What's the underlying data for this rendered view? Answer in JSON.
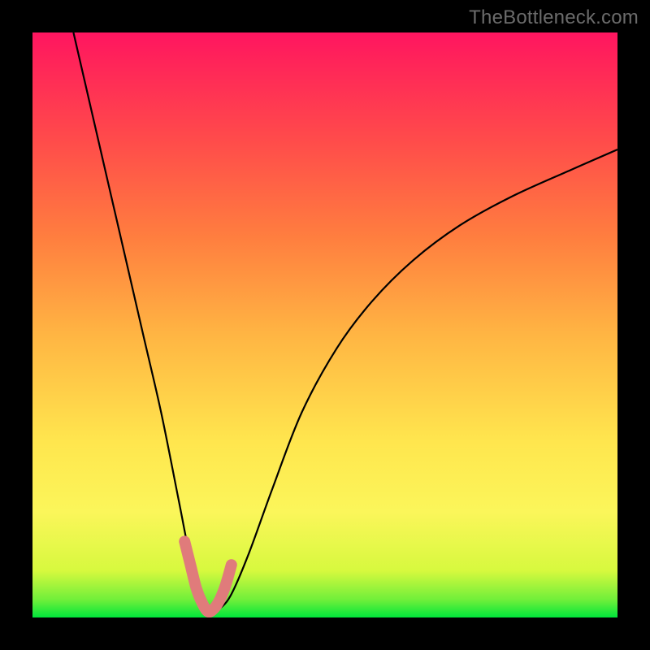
{
  "watermark": "TheBottleneck.com",
  "chart_data": {
    "type": "line",
    "title": "",
    "xlabel": "",
    "ylabel": "",
    "xlim": [
      0,
      100
    ],
    "ylim": [
      0,
      100
    ],
    "grid": false,
    "notes": "Bottleneck curve on a rainbow heat gradient. Axes are unlabeled; values are positional estimates. Valley floor is highlighted in pink.",
    "series": [
      {
        "name": "bottleneck-curve",
        "color": "#000000",
        "x": [
          7,
          10,
          13,
          16,
          19,
          22,
          25,
          27,
          29,
          30.5,
          32,
          34,
          37,
          41,
          46,
          52,
          58,
          65,
          73,
          82,
          92,
          100
        ],
        "y": [
          100,
          87,
          74,
          61,
          48,
          35,
          20,
          10,
          3,
          1,
          1.5,
          4,
          11,
          22,
          35,
          46,
          54,
          61,
          67,
          72,
          76.5,
          80
        ]
      },
      {
        "name": "valley-highlight",
        "color": "#e07b7b",
        "x": [
          26,
          27,
          28,
          29,
          30,
          31,
          32,
          33,
          34
        ],
        "y": [
          13,
          9,
          5,
          2.5,
          1,
          1.5,
          3,
          5.5,
          9
        ]
      }
    ]
  }
}
